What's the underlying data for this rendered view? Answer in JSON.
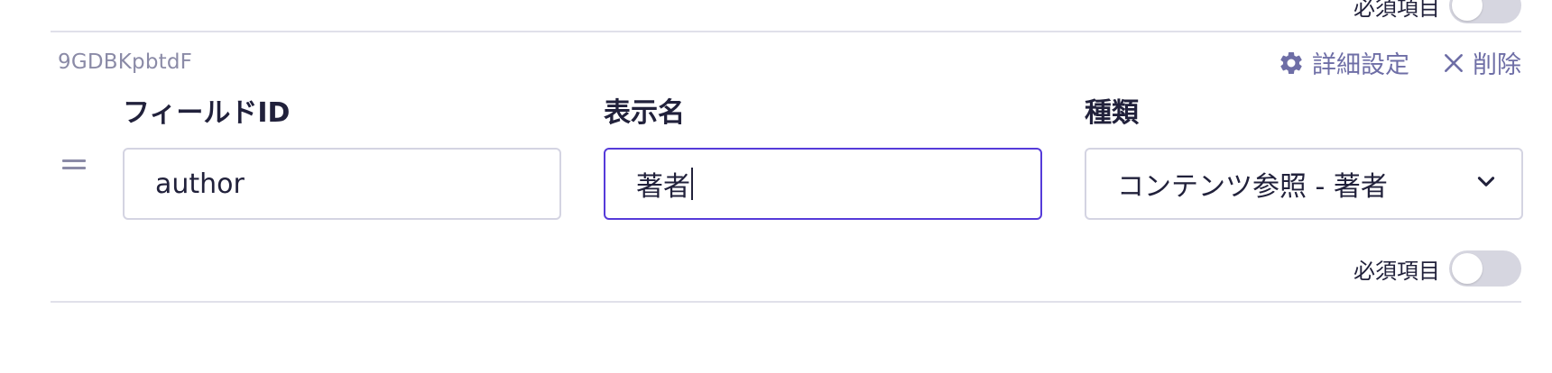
{
  "previous_field": {
    "required_label": "必須項目",
    "required_on": false
  },
  "field": {
    "code": "9GDBKpbtdF",
    "actions": {
      "settings_label": "詳細設定",
      "delete_label": "削除"
    },
    "columns": {
      "field_id_label": "フィールドID",
      "display_name_label": "表示名",
      "type_label": "種類"
    },
    "values": {
      "field_id": "author",
      "display_name": "著者",
      "type": "コンテンツ参照 - 著者"
    },
    "required_label": "必須項目",
    "required_on": false
  },
  "colors": {
    "accent": "#563bd9",
    "muted_text": "#8b8ba7",
    "action_text": "#6e6ea6",
    "border": "#d4d4e2",
    "toggle_off": "#d6d6e0"
  },
  "icons": {
    "settings": "gear-icon",
    "delete": "close-icon",
    "drag": "drag-handle-icon",
    "select": "chevron-down-icon"
  }
}
